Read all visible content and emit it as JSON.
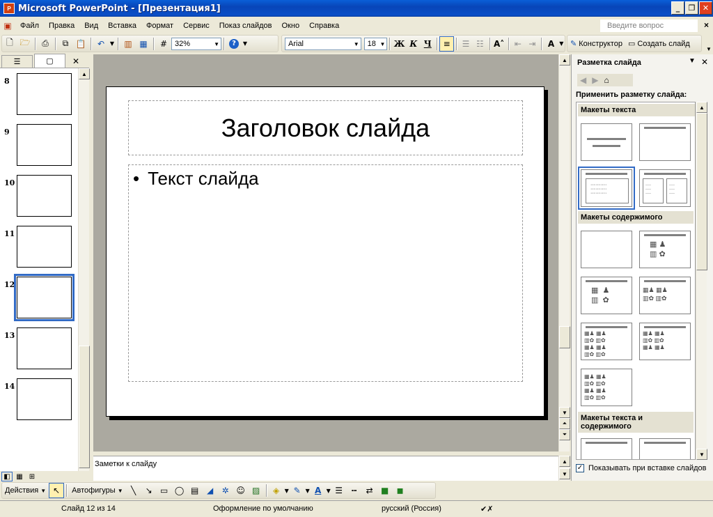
{
  "window": {
    "title": "Microsoft PowerPoint - [Презентация1]",
    "icon": "powerpoint-icon",
    "app_icon_text": "P"
  },
  "menu": {
    "items": [
      "Файл",
      "Правка",
      "Вид",
      "Вставка",
      "Формат",
      "Сервис",
      "Показ слайдов",
      "Окно",
      "Справка"
    ],
    "help_placeholder": "Введите вопрос"
  },
  "toolbar": {
    "zoom": "32%",
    "font": "Arial",
    "font_size": "18",
    "bold": "Ж",
    "italic": "К",
    "underline": "Ч",
    "designer": "Конструктор",
    "new_slide": "Создать слайд"
  },
  "slides": {
    "numbers": [
      "8",
      "9",
      "10",
      "11",
      "12",
      "13",
      "14"
    ],
    "selected": "12"
  },
  "slide": {
    "title": "Заголовок слайда",
    "body": "Текст слайда",
    "bullet": "•"
  },
  "notes": {
    "placeholder": "Заметки к слайду"
  },
  "task_pane": {
    "title": "Разметка слайда",
    "apply_label": "Применить разметку слайда:",
    "sections": [
      "Макеты текста",
      "Макеты содержимого",
      "Макеты текста и содержимого"
    ],
    "show_on_insert": "Показывать при вставке слайдов"
  },
  "drawing": {
    "actions": "Действия",
    "autoshapes": "Автофигуры"
  },
  "status": {
    "slide": "Слайд 12 из 14",
    "design": "Оформление по умолчанию",
    "language": "русский (Россия)"
  }
}
